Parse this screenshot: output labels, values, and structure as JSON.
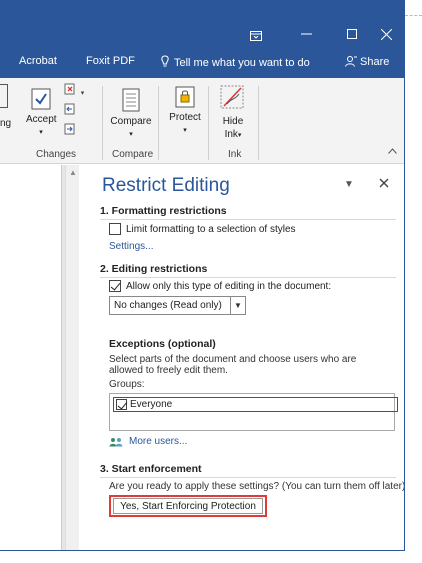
{
  "menubar": {
    "items": [
      "Acrobat",
      "Foxit PDF",
      "Tell me what you want to do",
      "Share"
    ]
  },
  "ribbon": {
    "partial_label": "ng",
    "accept": {
      "label": "Accept"
    },
    "compare": {
      "label": "Compare"
    },
    "protect": {
      "label": "Protect"
    },
    "hide_ink": {
      "label_line1": "Hide",
      "label_line2": "Ink"
    },
    "groups": [
      "Changes",
      "Compare",
      "Ink"
    ]
  },
  "pane": {
    "title": "Restrict Editing",
    "section1": {
      "heading": "1. Formatting restrictions",
      "checkbox_label": "Limit formatting to a selection of styles",
      "checked": false,
      "settings_link": "Settings..."
    },
    "section2": {
      "heading": "2. Editing restrictions",
      "checkbox_label": "Allow only this type of editing in the document:",
      "checked": true,
      "dropdown_value": "No changes (Read only)"
    },
    "exceptions": {
      "heading": "Exceptions (optional)",
      "description": "Select parts of the document and choose users who are allowed to freely edit them.",
      "groups_label": "Groups:",
      "group_item": "Everyone",
      "group_checked": true,
      "more_users": "More users..."
    },
    "section3": {
      "heading": "3. Start enforcement",
      "question": "Are you ready to apply these settings? (You can turn them off later)",
      "button_label": "Yes, Start Enforcing Protection"
    }
  },
  "colors": {
    "accent": "#2b579a",
    "highlight": "#e03a3a"
  }
}
